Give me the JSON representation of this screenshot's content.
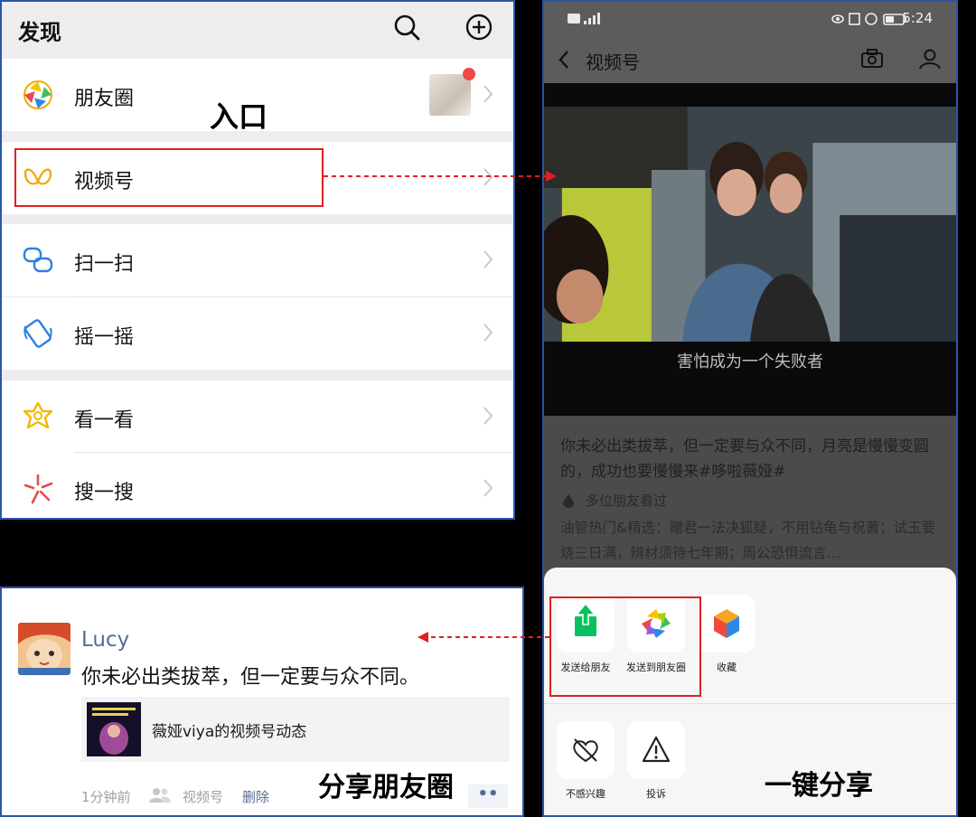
{
  "discover": {
    "title": "发现",
    "items": [
      {
        "label": "朋友圈",
        "icon": "moments-icon"
      },
      {
        "label": "视频号",
        "icon": "channels-icon"
      },
      {
        "label": "扫一扫",
        "icon": "scan-icon"
      },
      {
        "label": "摇一摇",
        "icon": "shake-icon"
      },
      {
        "label": "看一看",
        "icon": "top-stories-icon"
      },
      {
        "label": "搜一搜",
        "icon": "search-icon"
      }
    ],
    "caption": "入口"
  },
  "channels": {
    "status_time": "5:24",
    "title": "视频号",
    "subtitle_overlay": "害怕成为一个失败者",
    "description": "你未必出类拔萃，但一定要与众不同，月亮是慢慢变圆的，成功也要慢慢来#哆啦薇娅#",
    "friends_watched": "多位朋友看过",
    "more_text": "油管热门&精选：赠君一法决狐疑，不用钻龟与祝蓍；试玉要烧三日满，辨材须待七年期；周公恐惧流言…",
    "share_sheet": {
      "row1": [
        {
          "label": "发送给朋友",
          "icon": "share-upload-icon"
        },
        {
          "label": "发送到朋友圈",
          "icon": "moments-icon"
        },
        {
          "label": "收藏",
          "icon": "favorite-cube-icon"
        }
      ],
      "row2": [
        {
          "label": "不感兴趣",
          "icon": "broken-heart-icon"
        },
        {
          "label": "投诉",
          "icon": "warning-icon"
        }
      ]
    },
    "caption": "一键分享"
  },
  "moments_post": {
    "user": "Lucy",
    "text": "你未必出类拔萃，但一定要与众不同。",
    "card_title": "薇娅viya的视频号动态",
    "time": "1分钟前",
    "source": "视频号",
    "delete": "删除",
    "more": "••",
    "caption": "分享朋友圈"
  },
  "colors": {
    "annotation_red": "#e02020",
    "link_blue": "#576b95",
    "frame_blue": "#2b56a8",
    "wechat_green": "#07c160"
  }
}
